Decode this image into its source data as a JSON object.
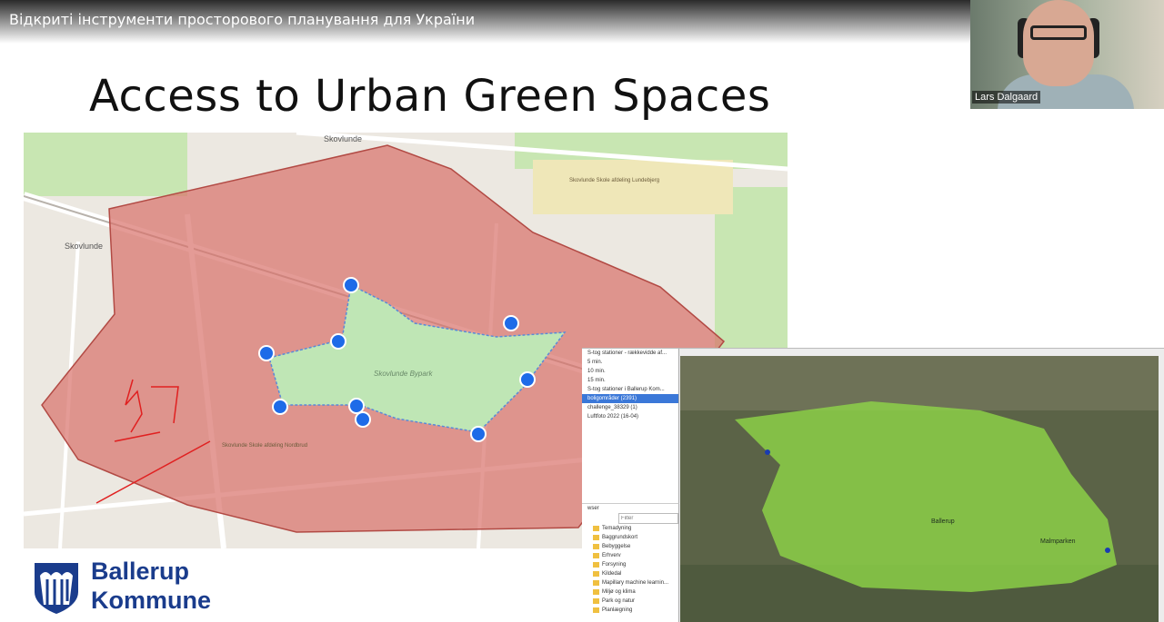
{
  "video": {
    "title": "Відкриті інструменти просторового планування для України"
  },
  "icons": {
    "clock": "clock-icon",
    "share": "share-icon"
  },
  "slide": {
    "title": "Access to Urban Green Spaces"
  },
  "webcam": {
    "name": "Lars Dalgaard"
  },
  "map_left": {
    "labels": {
      "top": "Skovlunde",
      "left": "Skovlunde",
      "park": "Skovlunde Bypark",
      "school_top": "Skovlunde Skole afdeling Lundebjerg",
      "school_bottom": "Skovlunde Skole afdeling Nordbrud"
    },
    "colors": {
      "zone": "#d9706a",
      "park": "#bfe6b5",
      "marker": "#1e6be8"
    }
  },
  "qgis": {
    "layers": [
      {
        "label": "S-tog stationer - rækkevidde af..."
      },
      {
        "label": "5 min."
      },
      {
        "label": "10 min."
      },
      {
        "label": "15 min."
      },
      {
        "label": "S-tog stationer i Ballerup Kom..."
      },
      {
        "label": "boligområder (2391)",
        "selected": true
      },
      {
        "label": "challenge_38329 (1)"
      },
      {
        "label": "Luftfoto 2022 (16-04)"
      }
    ],
    "browser_title": "wser",
    "filter_placeholder": "Filter",
    "browser_items": [
      "Temadyning",
      "Baggrundskort",
      "Bebyggelse",
      "Erhverv",
      "Forsyning",
      "Kildedal",
      "Mapillary machine learnin...",
      "Miljø og klima",
      "Park og natur",
      "Planlægning"
    ],
    "sat_labels": {
      "center": "Ballerup",
      "east": "Malmparken"
    },
    "colors": {
      "zone": "#8fd848"
    }
  },
  "logo": {
    "line1": "Ballerup",
    "line2": "Kommune"
  }
}
